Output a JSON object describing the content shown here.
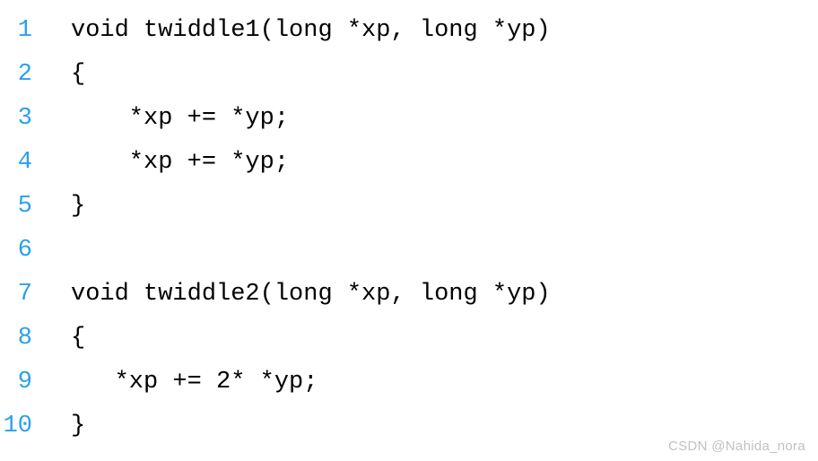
{
  "code": {
    "lines": [
      {
        "num": "1",
        "text": "void twiddle1(long *xp, long *yp)"
      },
      {
        "num": "2",
        "text": "{"
      },
      {
        "num": "3",
        "text": "    *xp += *yp;"
      },
      {
        "num": "4",
        "text": "    *xp += *yp;"
      },
      {
        "num": "5",
        "text": "}"
      },
      {
        "num": "6",
        "text": ""
      },
      {
        "num": "7",
        "text": "void twiddle2(long *xp, long *yp)"
      },
      {
        "num": "8",
        "text": "{"
      },
      {
        "num": "9",
        "text": "   *xp += 2* *yp;"
      },
      {
        "num": "10",
        "text": "}"
      }
    ]
  },
  "watermark": "CSDN @Nahida_nora"
}
